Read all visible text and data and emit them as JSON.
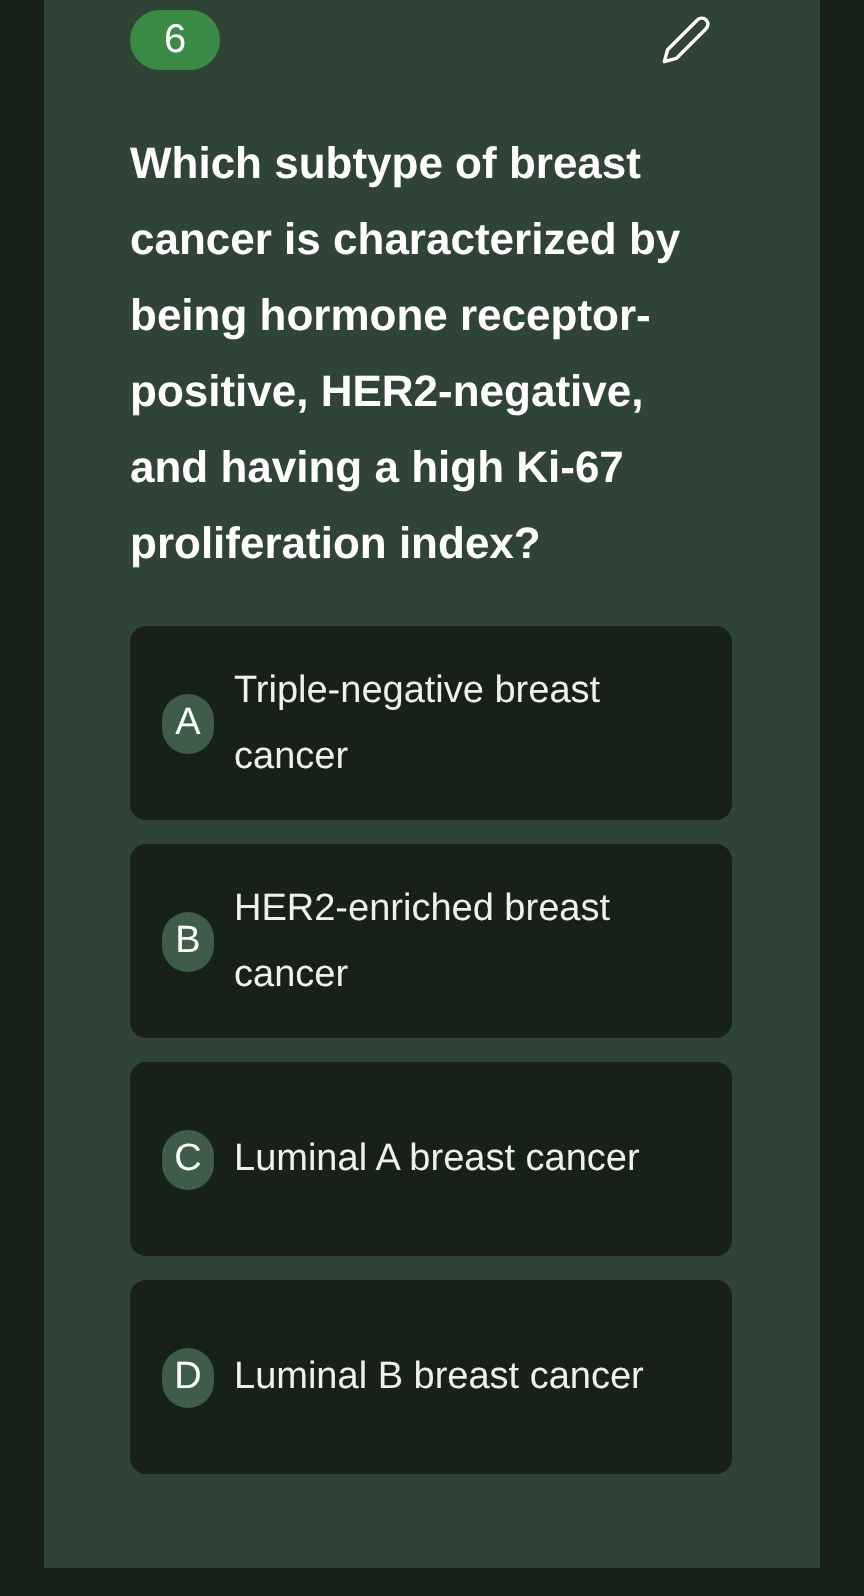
{
  "question": {
    "number": "6",
    "text": "Which subtype of breast cancer is characterized by being hormone receptor-positive, HER2-negative, and having a high Ki-67 proliferation index?"
  },
  "options": [
    {
      "letter": "A",
      "text": "Triple-negative breast cancer"
    },
    {
      "letter": "B",
      "text": "HER2-enriched breast cancer"
    },
    {
      "letter": "C",
      "text": "Luminal A breast cancer"
    },
    {
      "letter": "D",
      "text": "Luminal B breast cancer"
    }
  ]
}
